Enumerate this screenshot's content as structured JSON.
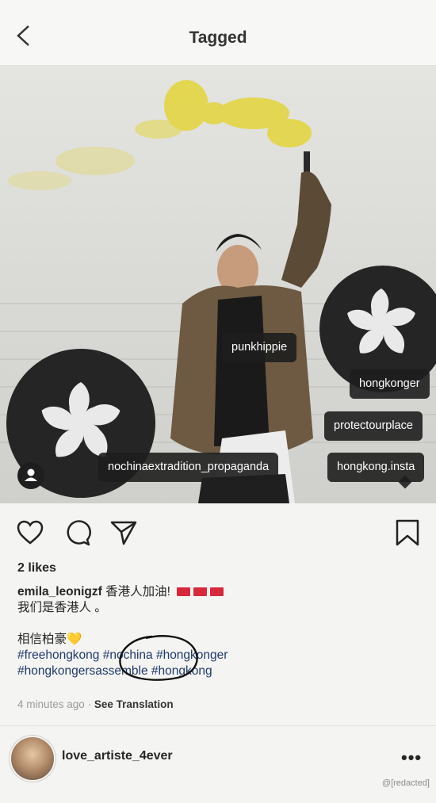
{
  "header": {
    "title": "Tagged"
  },
  "photo": {
    "tags": [
      {
        "id": "punkhippie",
        "label": "punkhippie"
      },
      {
        "id": "hongkonger",
        "label": "hongkonger"
      },
      {
        "id": "protectourplace",
        "label": "protectourplace"
      },
      {
        "id": "nochinaextradition",
        "label": "nochinaextradition_propaganda"
      },
      {
        "id": "hongkonginsta",
        "label": "hongkong.insta"
      }
    ]
  },
  "post": {
    "likes": "2 likes",
    "username": "emila_leonigzf",
    "caption_line1": "香港人加油!",
    "caption_line2": "我们是香港人 。",
    "caption_line3": "相信柏豪💛",
    "hashtags_line1": "#freehongkong #nochina #hongkonger",
    "hashtags_line2": "#hongkongersassemble #hongkong",
    "time": "4 minutes ago",
    "separator": " · ",
    "see_translation": "See Translation"
  },
  "comment": {
    "username": "love_artiste_4ever",
    "more": "•••"
  },
  "watermark": "@[redacted]"
}
